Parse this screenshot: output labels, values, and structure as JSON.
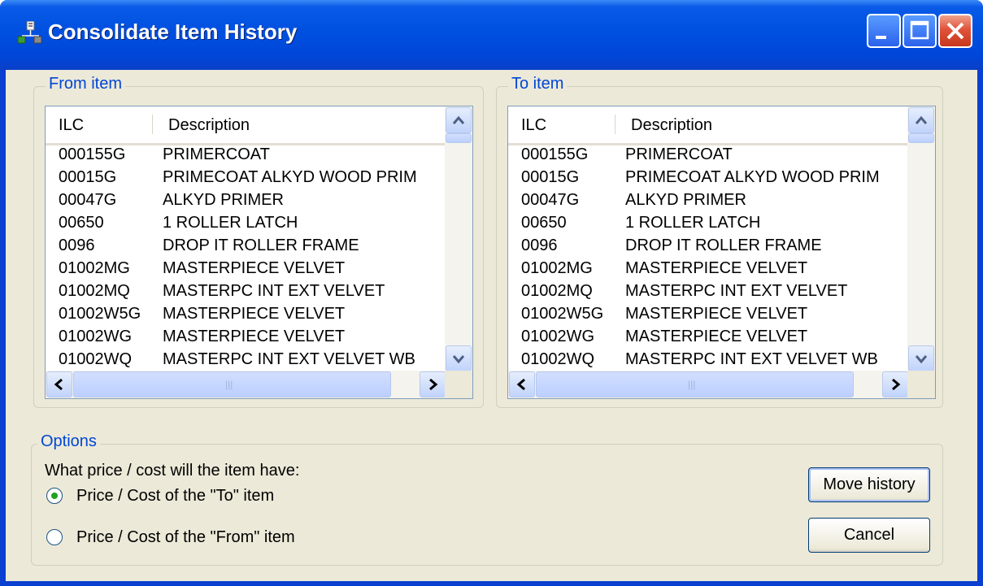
{
  "window": {
    "title": "Consolidate Item History",
    "icon": "tree-structure-icon"
  },
  "from_group": {
    "label": "From item",
    "columns": [
      "ILC",
      "Description"
    ],
    "rows": [
      {
        "ilc": "000155G",
        "desc": "PRIMERCOAT"
      },
      {
        "ilc": "00015G",
        "desc": "PRIMECOAT ALKYD WOOD PRIM"
      },
      {
        "ilc": "00047G",
        "desc": "ALKYD PRIMER"
      },
      {
        "ilc": "00650",
        "desc": "1 ROLLER LATCH"
      },
      {
        "ilc": "0096",
        "desc": "DROP IT ROLLER FRAME"
      },
      {
        "ilc": "01002MG",
        "desc": "MASTERPIECE VELVET"
      },
      {
        "ilc": "01002MQ",
        "desc": "MASTERPC INT EXT VELVET"
      },
      {
        "ilc": "01002W5G",
        "desc": "MASTERPIECE VELVET"
      },
      {
        "ilc": "01002WG",
        "desc": "MASTERPIECE VELVET"
      },
      {
        "ilc": "01002WQ",
        "desc": "MASTERPC INT EXT VELVET WB"
      }
    ]
  },
  "to_group": {
    "label": "To item",
    "columns": [
      "ILC",
      "Description"
    ],
    "rows": [
      {
        "ilc": "000155G",
        "desc": "PRIMERCOAT"
      },
      {
        "ilc": "00015G",
        "desc": "PRIMECOAT ALKYD WOOD PRIM"
      },
      {
        "ilc": "00047G",
        "desc": "ALKYD PRIMER"
      },
      {
        "ilc": "00650",
        "desc": "1 ROLLER LATCH"
      },
      {
        "ilc": "0096",
        "desc": "DROP IT ROLLER FRAME"
      },
      {
        "ilc": "01002MG",
        "desc": "MASTERPIECE VELVET"
      },
      {
        "ilc": "01002MQ",
        "desc": "MASTERPC INT EXT VELVET"
      },
      {
        "ilc": "01002W5G",
        "desc": "MASTERPIECE VELVET"
      },
      {
        "ilc": "01002WG",
        "desc": "MASTERPIECE VELVET"
      },
      {
        "ilc": "01002WQ",
        "desc": "MASTERPC INT EXT VELVET WB"
      }
    ]
  },
  "options": {
    "label": "Options",
    "question": "What price / cost will the item have:",
    "radio_to": "Price / Cost of the \"To\" item",
    "radio_from": "Price / Cost of the \"From\" item",
    "selected": "to"
  },
  "buttons": {
    "move": "Move history",
    "cancel": "Cancel"
  },
  "colors": {
    "titlebar": "#0054e3",
    "group_label": "#0046d5",
    "dialog_bg": "#ece9d8"
  }
}
